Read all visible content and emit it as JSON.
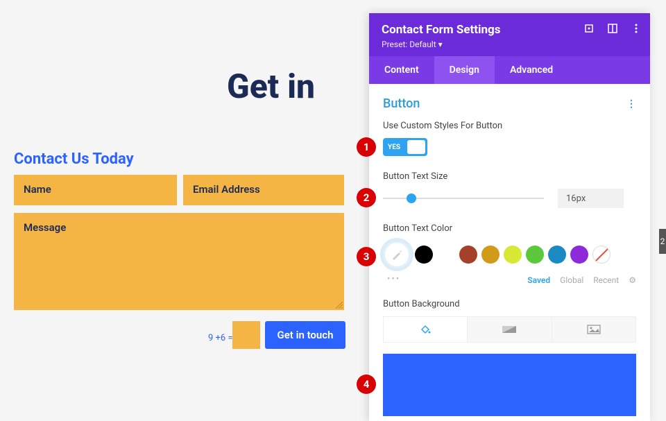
{
  "heading": "Get in",
  "form_title": "Contact Us Today",
  "fields": {
    "name": "Name",
    "email": "Email Address",
    "message": "Message"
  },
  "captcha": "9 +6 =",
  "submit": "Get in touch",
  "panel": {
    "title": "Contact Form Settings",
    "preset": "Preset: Default ▾",
    "tabs": [
      "Content",
      "Design",
      "Advanced"
    ],
    "active_tab": 1,
    "section": "Button",
    "opts": {
      "custom_label": "Use Custom Styles For Button",
      "toggle": "YES",
      "size_label": "Button Text Size",
      "size_value": "16px",
      "color_label": "Button Text Color",
      "bg_label": "Button Background"
    },
    "palette": [
      "#000000",
      "#ffffff",
      "#a5402a",
      "#d39a1a",
      "#d8e835",
      "#5cc83b",
      "#1b8ac2",
      "#8e2bd9"
    ],
    "swatch_tabs": [
      "Saved",
      "Global",
      "Recent"
    ],
    "bg_color": "#2c63ff"
  },
  "annotations": [
    "1",
    "2",
    "3",
    "4"
  ],
  "edge_num": "2"
}
